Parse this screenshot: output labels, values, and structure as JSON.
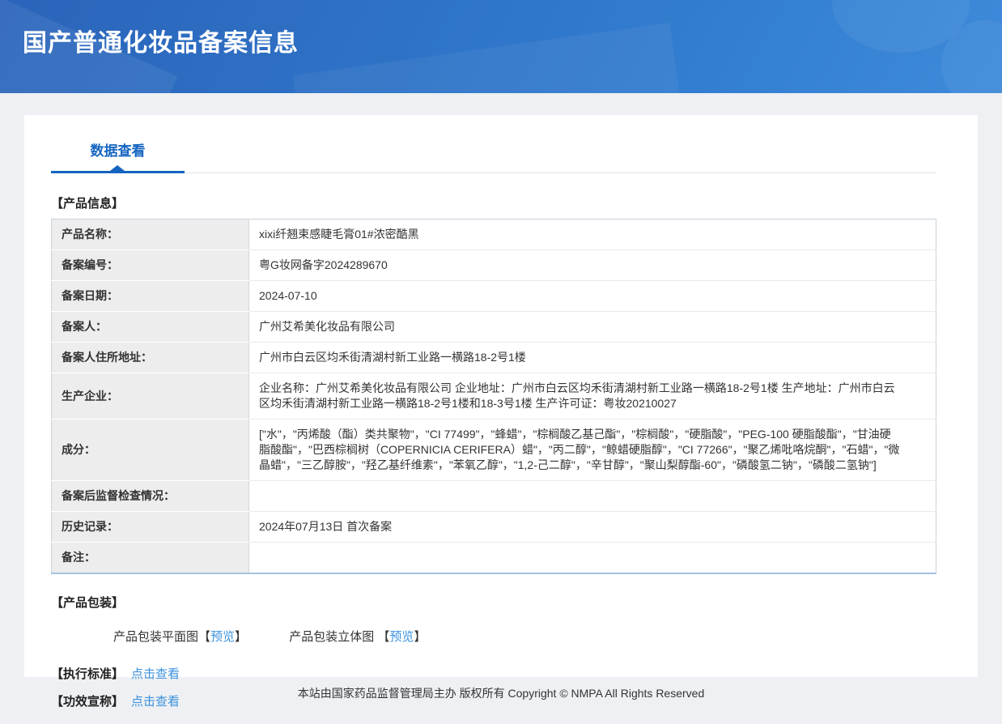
{
  "banner": {
    "title": "国产普通化妆品备案信息"
  },
  "tab": {
    "label": "数据查看"
  },
  "product_info": {
    "heading": "【产品信息】",
    "rows": [
      {
        "label": "产品名称：",
        "value": "xixi纤翘束感睫毛膏01#浓密酷黑"
      },
      {
        "label": "备案编号：",
        "value": "粤G妆网备字2024289670"
      },
      {
        "label": "备案日期：",
        "value": "2024-07-10"
      },
      {
        "label": "备案人：",
        "value": "广州艾希美化妆品有限公司"
      },
      {
        "label": "备案人住所地址：",
        "value": "广州市白云区均禾街清湖村新工业路一横路18-2号1楼"
      },
      {
        "label": "生产企业：",
        "value": "企业名称：广州艾希美化妆品有限公司 企业地址：广州市白云区均禾街清湖村新工业路一横路18-2号1楼 生产地址：广州市白云区均禾街清湖村新工业路一横路18-2号1楼和18-3号1楼 生产许可证：粤妆20210027"
      },
      {
        "label": "成分：",
        "value": "[\"水\"，\"丙烯酸（酯）类共聚物\"，\"CI 77499\"，\"蜂蜡\"，\"棕榈酸乙基己酯\"，\"棕榈酸\"，\"硬脂酸\"，\"PEG-100 硬脂酸酯\"，\"甘油硬脂酸酯\"，\"巴西棕榈树（COPERNICIA CERIFERA）蜡\"，\"丙二醇\"，\"鲸蜡硬脂醇\"，\"CI 77266\"，\"聚乙烯吡咯烷酮\"，\"石蜡\"，\"微晶蜡\"，\"三乙醇胺\"，\"羟乙基纤维素\"，\"苯氧乙醇\"，\"1,2-己二醇\"，\"辛甘醇\"，\"聚山梨醇酯-60\"，\"磷酸氢二钠\"，\"磷酸二氢钠\"]"
      },
      {
        "label": "备案后监督检查情况：",
        "value": ""
      },
      {
        "label": "历史记录：",
        "value": "2024年07月13日 首次备案"
      },
      {
        "label": "备注：",
        "value": ""
      }
    ]
  },
  "packaging": {
    "heading": "【产品包装】",
    "items": [
      {
        "label": "产品包装平面图",
        "bracket_open": "【",
        "link": "预览",
        "bracket_close": "】"
      },
      {
        "label": "产品包装立体图 ",
        "bracket_open": "【",
        "link": "预览",
        "bracket_close": "】"
      }
    ]
  },
  "standard": {
    "heading": "【执行标准】",
    "link": "点击查看"
  },
  "efficacy": {
    "heading": "【功效宣称】",
    "link": "点击查看"
  },
  "footer": {
    "text": "本站由国家药品监督管理局主办 版权所有 Copyright © NMPA All Rights Reserved"
  },
  "colors": {
    "banner_gradient_start": "#2b64ba",
    "banner_gradient_end": "#3f8ad9",
    "tab_blue": "#1565c1",
    "link_blue": "#3c92de",
    "label_cell_bg": "#ededed",
    "table_bottom_border": "#a3c3e4"
  }
}
